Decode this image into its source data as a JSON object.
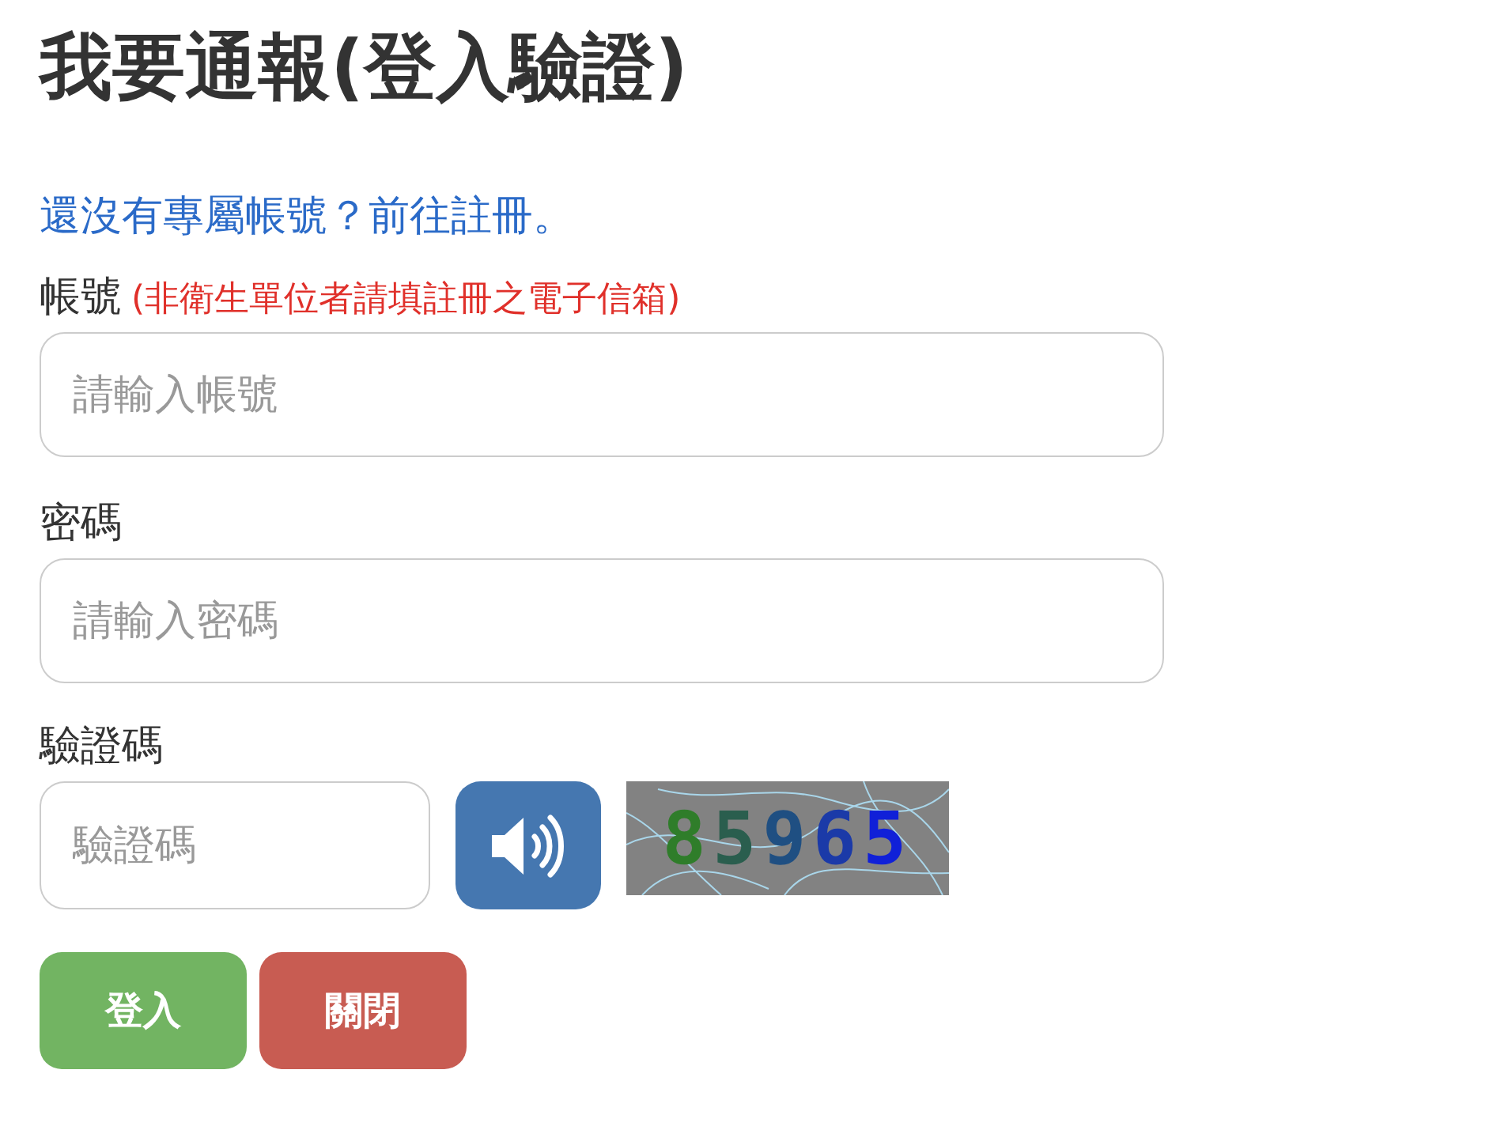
{
  "heading": "我要通報(登入驗證)",
  "register_link": "還沒有專屬帳號？前往註冊。",
  "fields": [
    {
      "label": "帳號",
      "note": "(非衛生單位者請填註冊之電子信箱)",
      "placeholder": "請輸入帳號"
    },
    {
      "label": "密碼",
      "placeholder": "請輸入密碼"
    }
  ],
  "captcha": {
    "label": "驗證碼",
    "placeholder": "驗證碼",
    "code": "85965"
  },
  "buttons": [
    {
      "kind": "primary",
      "label": "登入"
    },
    {
      "kind": "danger",
      "label": "關閉"
    }
  ]
}
